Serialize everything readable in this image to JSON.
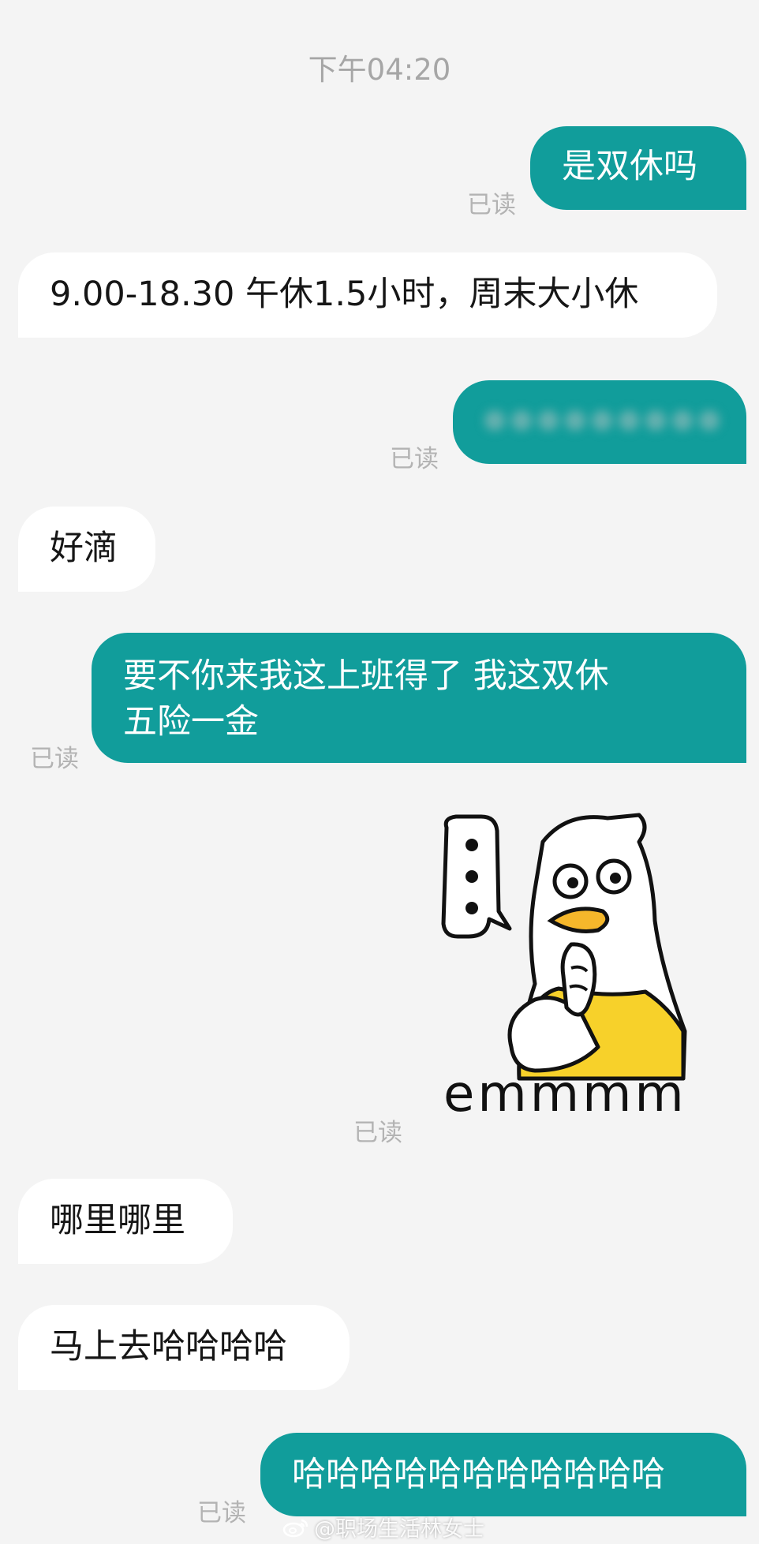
{
  "timestamp": "下午04:20",
  "messages": [
    {
      "text": "是双休吗",
      "read": "已读"
    },
    {
      "text": "9.00-18.30 午休1.5小时，周末大小休"
    },
    {
      "read": "已读"
    },
    {
      "text": "好滴"
    },
    {
      "line1": "要不你来我这上班得了 我这双休",
      "line2": "五险一金",
      "read": "已读"
    },
    {
      "sticker_caption": "emmmm",
      "read": "已读"
    },
    {
      "text": "哪里哪里"
    },
    {
      "text": "马上去哈哈哈哈"
    },
    {
      "text": "哈哈哈哈哈哈哈哈哈哈哈",
      "read": "已读"
    }
  ],
  "watermark": "@职场生活林女士",
  "icons": {
    "sticker": "duck-thinking-sticker",
    "watermark": "weibo-icon"
  },
  "colors": {
    "outgoing_bubble": "#119d9b",
    "incoming_bubble": "#ffffff",
    "background": "#f4f4f4",
    "sticker_shirt": "#f7d12a"
  }
}
